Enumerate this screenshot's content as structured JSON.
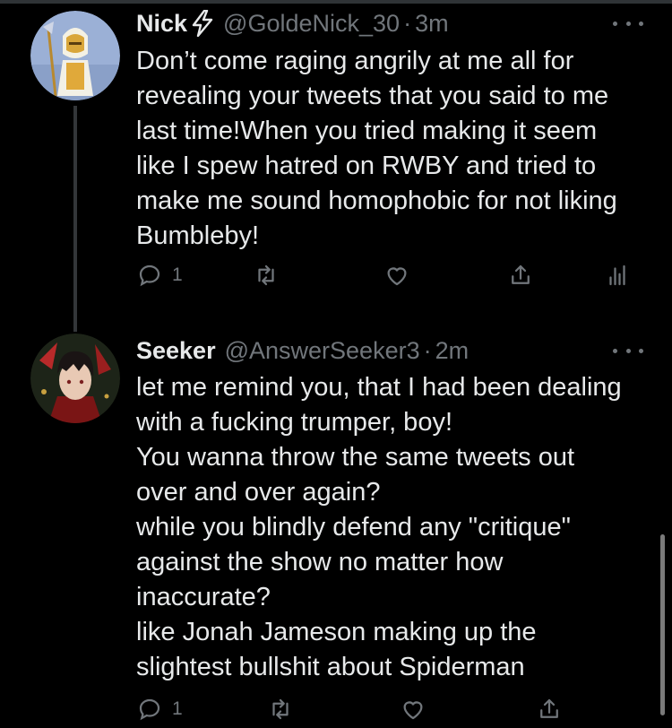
{
  "tweets": [
    {
      "name": "Nick",
      "badge": "⚡",
      "handle": "@GoldeNick_30",
      "time": "3m",
      "lines": [
        "Don’t come raging angrily at me all for",
        "revealing your tweets that you said to me",
        "last time!When you tried making it seem",
        "like I spew hatred on RWBY and tried to",
        "make me sound homophobic for not liking",
        "Bumbleby!"
      ],
      "reply_count": "1"
    },
    {
      "name": "Seeker",
      "handle": "@AnswerSeeker3",
      "time": "2m",
      "lines": [
        "let me remind you, that I had been dealing",
        "with a fucking trumper, boy!",
        "You wanna throw the same tweets out",
        "over and over again?",
        "while you blindly defend any \"critique\"",
        "against the show no matter how",
        "inaccurate?",
        "like Jonah Jameson making up the",
        "slightest bullshit about Spiderman"
      ],
      "reply_count": "1"
    }
  ],
  "colors": {
    "text": "#e7e9ea",
    "muted": "#71767b",
    "background": "#000000",
    "badge": "#e7e9ea"
  },
  "icons": [
    "reply-icon",
    "retweet-icon",
    "like-icon",
    "share-icon",
    "analytics-icon",
    "more-icon",
    "lightning-icon"
  ]
}
